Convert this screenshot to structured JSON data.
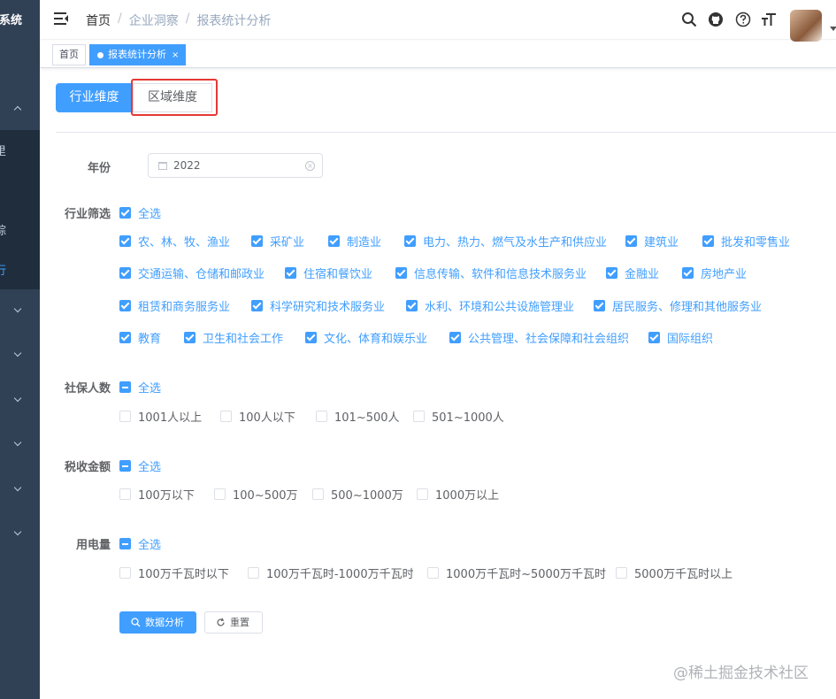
{
  "sidebar": {
    "title": "理系统",
    "items": [
      {
        "label": "里"
      },
      {
        "label": "综"
      },
      {
        "label": "行"
      }
    ]
  },
  "header": {
    "breadcrumb": [
      "首页",
      "企业洞察",
      "报表统计分析"
    ],
    "separator": "/"
  },
  "tags": {
    "home": "首页",
    "active": "报表统计分析",
    "close": "×"
  },
  "tabs": {
    "industry": "行业维度",
    "region": "区域维度"
  },
  "filters": {
    "year": {
      "label": "年份",
      "value": "2022"
    },
    "industry": {
      "label": "行业筛选",
      "all": "全选",
      "rows": [
        [
          "农、林、牧、渔业",
          "采矿业",
          "制造业",
          "电力、热力、燃气及水生产和供应业",
          "建筑业",
          "批发和零售业"
        ],
        [
          "交通运输、仓储和邮政业",
          "住宿和餐饮业",
          "信息传输、软件和信息技术服务业",
          "金融业",
          "房地产业"
        ],
        [
          "租赁和商务服务业",
          "科学研究和技术服务业",
          "水利、环境和公共设施管理业",
          "居民服务、修理和其他服务业"
        ],
        [
          "教育",
          "卫生和社会工作",
          "文化、体育和娱乐业",
          "公共管理、社会保障和社会组织",
          "国际组织"
        ]
      ]
    },
    "social_security": {
      "label": "社保人数",
      "all": "全选",
      "options": [
        "1001人以上",
        "100人以下",
        "101~500人",
        "501~1000人"
      ]
    },
    "tax": {
      "label": "税收金额",
      "all": "全选",
      "options": [
        "100万以下",
        "100~500万",
        "500~1000万",
        "1000万以上"
      ]
    },
    "power": {
      "label": "用电量",
      "all": "全选",
      "options": [
        "100万千瓦时以下",
        "100万千瓦时-1000万千瓦时",
        "1000万千瓦时~5000万千瓦时",
        "5000万千瓦时以上"
      ]
    }
  },
  "actions": {
    "analyze": "数据分析",
    "reset": "重置"
  },
  "watermark": "@稀土掘金技术社区",
  "colors": {
    "primary": "#409eff",
    "sidebar": "#304156",
    "highlight": "#e53935"
  }
}
